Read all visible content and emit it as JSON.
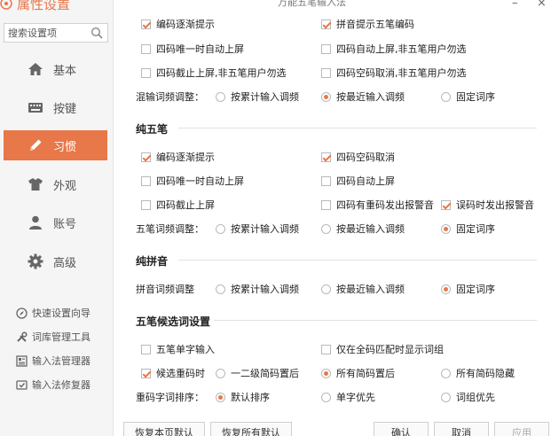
{
  "app": {
    "title": "属性设置"
  },
  "search": {
    "placeholder": "搜索设置项"
  },
  "nav": [
    {
      "label": "基本",
      "icon": "home-icon"
    },
    {
      "label": "按键",
      "icon": "keyboard-icon"
    },
    {
      "label": "习惯",
      "icon": "pencil-icon",
      "active": true
    },
    {
      "label": "外观",
      "icon": "shirt-icon"
    },
    {
      "label": "账号",
      "icon": "user-icon"
    },
    {
      "label": "高级",
      "icon": "gear-icon"
    }
  ],
  "tools": [
    {
      "label": "快速设置向导",
      "icon": "compass-icon"
    },
    {
      "label": "词库管理工具",
      "icon": "tools-icon"
    },
    {
      "label": "输入法管理器",
      "icon": "manager-icon"
    },
    {
      "label": "输入法修复器",
      "icon": "repair-icon"
    }
  ],
  "window": {
    "title": "万能五笔输入法",
    "minimize": "–",
    "close": "×"
  },
  "section1": {
    "opt_encode_hint": "编码逐渐提示",
    "opt_pinyin_wubi": "拼音提示五笔编码",
    "opt_unique_auto": "四码唯一时自动上屏",
    "opt_auto_nonwubi": "四码自动上屏,非五笔用户勿选",
    "opt_cut_nonwubi": "四码截止上屏,非五笔用户勿选",
    "opt_empty_cancel_nonwubi": "四码空码取消,非五笔用户勿选",
    "freq_label": "混输词频调整：",
    "freq_cumulative": "按累计输入调频",
    "freq_recent": "按最近输入调频",
    "freq_fixed": "固定词序"
  },
  "section2": {
    "title": "纯五笔",
    "opt_encode_hint": "编码逐渐提示",
    "opt_empty_cancel": "四码空码取消",
    "opt_unique_auto": "四码唯一时自动上屏",
    "opt_auto": "四码自动上屏",
    "opt_cut": "四码截止上屏",
    "opt_dup_alert": "四码有重码发出报警音",
    "opt_error_alert": "误码时发出报警音",
    "freq_label": "五笔词频调整：",
    "freq_cumulative": "按累计输入调频",
    "freq_recent": "按最近输入调频",
    "freq_fixed": "固定词序"
  },
  "section3": {
    "title": "纯拼音",
    "freq_label": "拼音词频调整",
    "freq_cumulative": "按累计输入调频",
    "freq_recent": "按最近输入调频",
    "freq_fixed": "固定词序"
  },
  "section4": {
    "title": "五笔候选词设置",
    "opt_single_char": "五笔单字输入",
    "opt_full_phrase": "仅在全码匹配时显示词组",
    "opt_dup_code": "候选重码时",
    "opt_level12": "一二级简码置后",
    "opt_all_after": "所有简码置后",
    "opt_all_hide": "所有简码隐藏",
    "sort_label": "重码字词排序：",
    "sort_default": "默认排序",
    "sort_single": "单字优先",
    "sort_phrase": "词组优先"
  },
  "footer": {
    "restore_page": "恢复本页默认",
    "restore_all": "恢复所有默认",
    "ok": "确认",
    "cancel": "取消",
    "apply": "应用"
  },
  "colors": {
    "accent": "#e8774a"
  }
}
